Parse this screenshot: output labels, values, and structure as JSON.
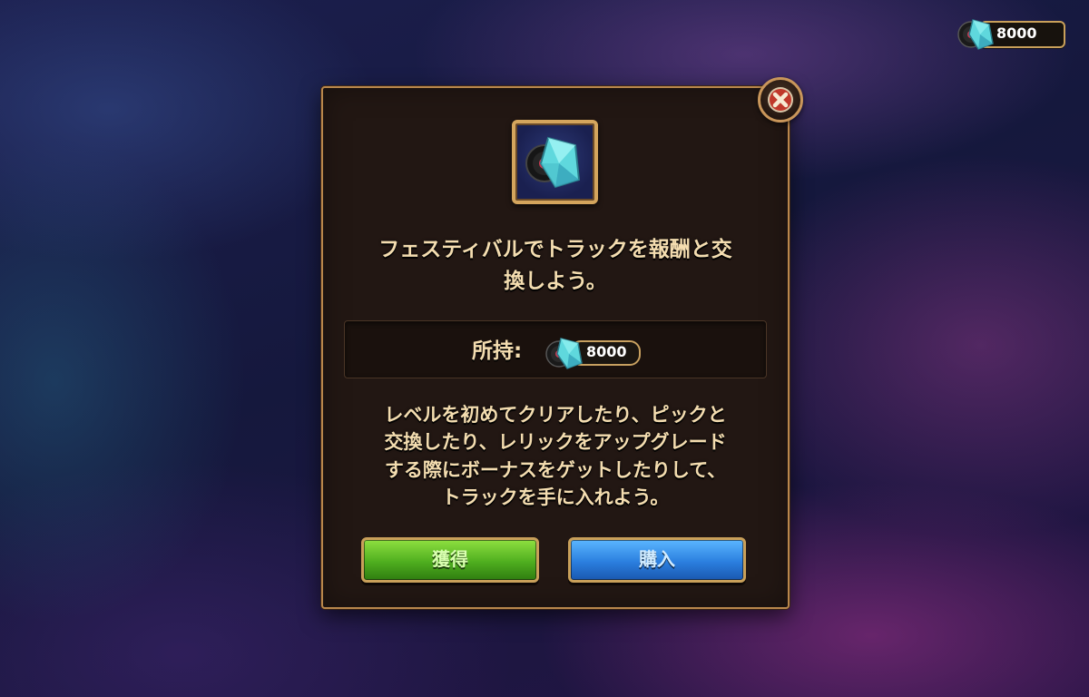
{
  "currency": {
    "amount": "8000",
    "icon": "track-gem-icon"
  },
  "modal": {
    "close_icon": "close-icon",
    "item_icon": "track-gem-icon",
    "title_line1": "フェスティバルでトラックを報酬と交",
    "title_line2": "換しよう。",
    "owned_label": "所持:",
    "owned_amount": "8000",
    "description_lines": [
      "レベルを初めてクリアしたり、ピックと",
      "交換したり、レリックをアップグレード",
      "する際にボーナスをゲットしたりして、",
      "トラックを手に入れよう。"
    ],
    "obtain_label": "獲得",
    "buy_label": "購入"
  },
  "colors": {
    "text_cream": "#f4ddb0",
    "panel_bg": "#221713",
    "border_gold": "#c9a05a",
    "obtain_green": "#4fae1f",
    "buy_blue": "#2b7fdf",
    "close_red": "#c0392b"
  }
}
